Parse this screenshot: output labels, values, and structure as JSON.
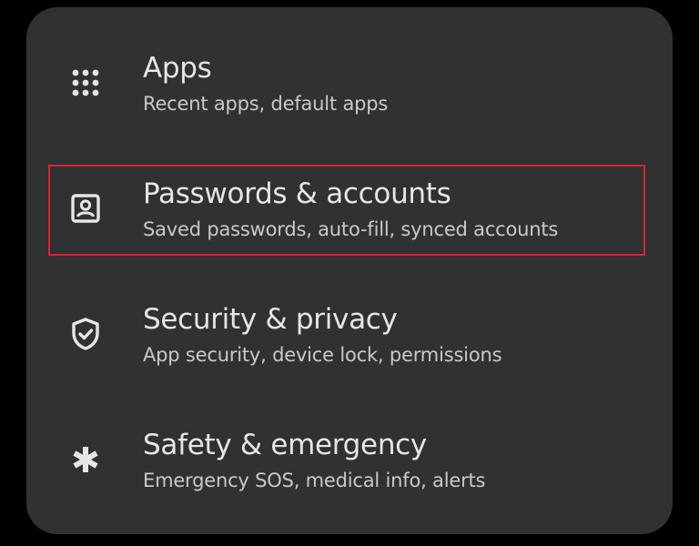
{
  "settings": {
    "items": [
      {
        "icon": "apps-grid-icon",
        "title": "Apps",
        "subtitle": "Recent apps, default apps"
      },
      {
        "icon": "account-box-icon",
        "title": "Passwords & accounts",
        "subtitle": "Saved passwords, auto-fill, synced accounts"
      },
      {
        "icon": "shield-check-icon",
        "title": "Security & privacy",
        "subtitle": "App security, device lock, permissions"
      },
      {
        "icon": "asterisk-icon",
        "title": "Safety & emergency",
        "subtitle": "Emergency SOS, medical info, alerts"
      }
    ],
    "highlighted_item": "Passwords & accounts",
    "colors": {
      "background": "#000000",
      "card": "#2f3133",
      "title": "#e6e6e6",
      "subtitle": "#c8c9cb",
      "icon": "#e6e6e6",
      "highlight": "#e0222d"
    }
  }
}
